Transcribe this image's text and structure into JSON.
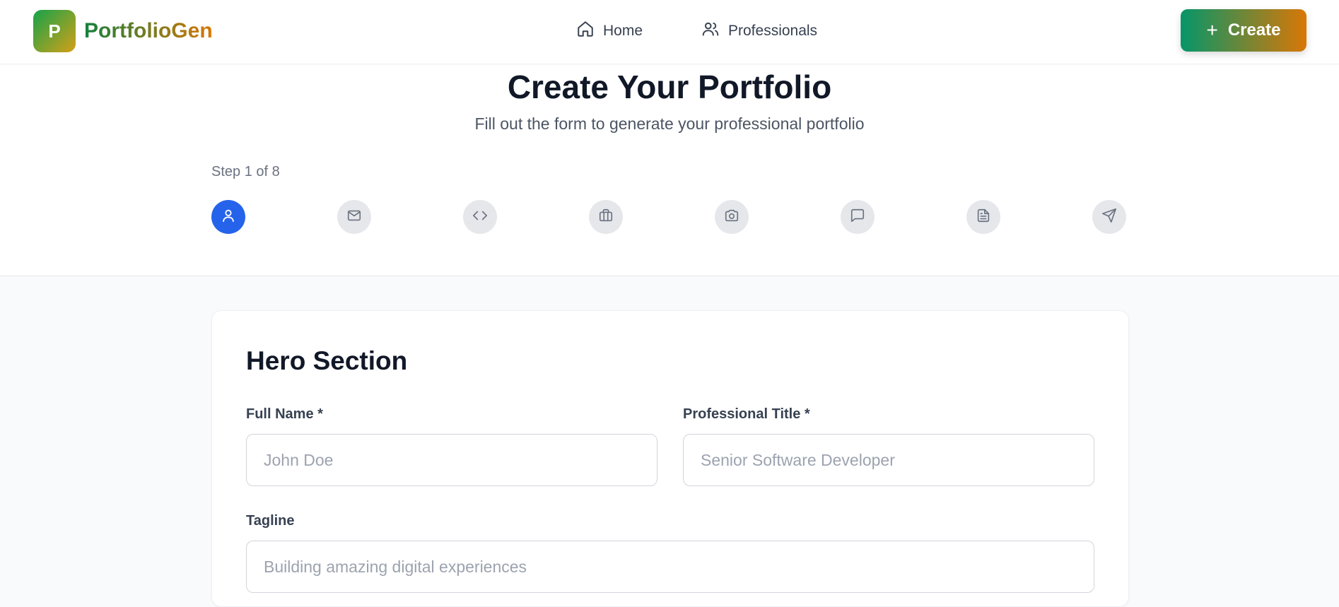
{
  "header": {
    "logo_letter": "P",
    "brand": "PortfolioGen",
    "nav": [
      {
        "label": "Home",
        "icon": "home-icon"
      },
      {
        "label": "Professionals",
        "icon": "users-icon"
      }
    ],
    "create_label": "Create",
    "colors": {
      "brand_start": "#15803d",
      "brand_end": "#d97706"
    }
  },
  "hero": {
    "title": "Create Your Portfolio",
    "subtitle": "Fill out the form to generate your professional portfolio",
    "step_label": "Step 1 of 8",
    "current_step": 1,
    "total_steps": 8,
    "steps": [
      {
        "icon": "user-icon",
        "active": true
      },
      {
        "icon": "mail-icon",
        "active": false
      },
      {
        "icon": "code-icon",
        "active": false
      },
      {
        "icon": "briefcase-icon",
        "active": false
      },
      {
        "icon": "camera-icon",
        "active": false
      },
      {
        "icon": "message-icon",
        "active": false
      },
      {
        "icon": "document-icon",
        "active": false
      },
      {
        "icon": "send-icon",
        "active": false
      }
    ],
    "active_color": "#2563eb"
  },
  "form": {
    "section_title": "Hero Section",
    "full_name": {
      "label": "Full Name *",
      "placeholder": "John Doe",
      "value": ""
    },
    "professional_title": {
      "label": "Professional Title *",
      "placeholder": "Senior Software Developer",
      "value": ""
    },
    "tagline": {
      "label": "Tagline",
      "placeholder": "Building amazing digital experiences",
      "value": ""
    }
  }
}
